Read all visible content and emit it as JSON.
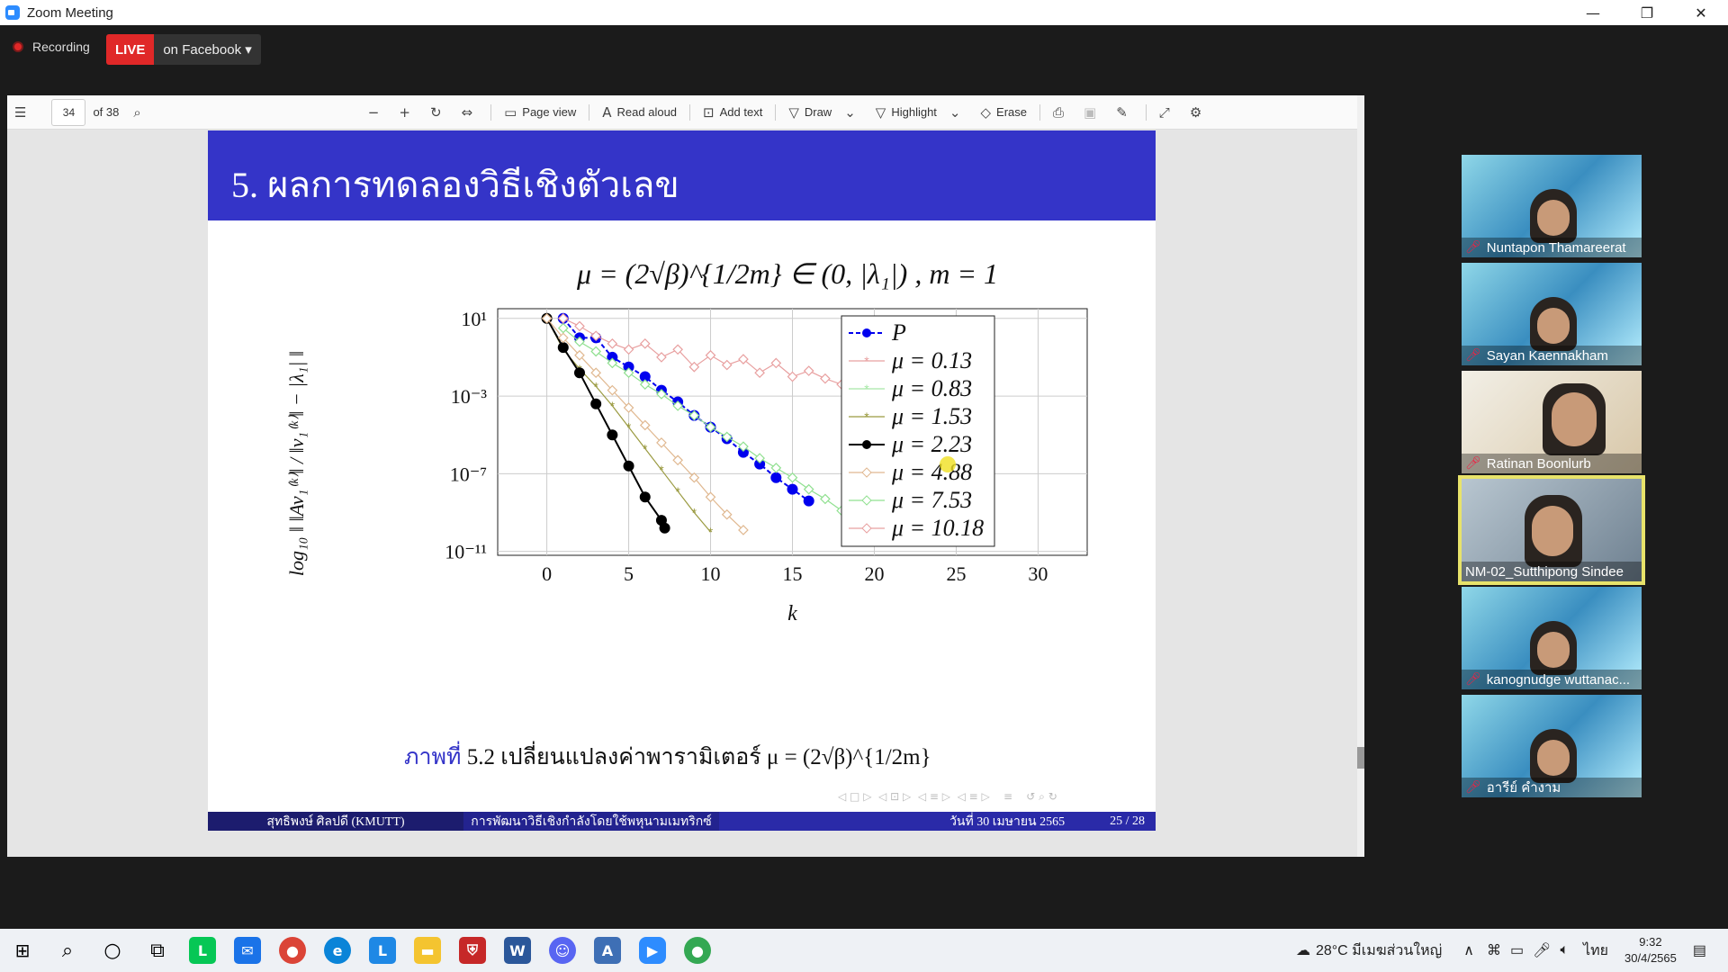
{
  "window": {
    "title": "Zoom Meeting"
  },
  "recording": {
    "label": "Recording",
    "live_badge": "LIVE",
    "live_target": "on Facebook"
  },
  "pdf_toolbar": {
    "page_current": "34",
    "page_total": "of 38",
    "page_view": "Page view",
    "read_aloud": "Read aloud",
    "add_text": "Add text",
    "draw": "Draw",
    "highlight": "Highlight",
    "erase": "Erase"
  },
  "slide": {
    "title": "5. ผลการทดลองวิธีเชิงตัวเลข",
    "formula": "μ = (2√β)^{1/2m} ∈ (0, |λ₁|) , m = 1",
    "y_axis_label": "log₁₀ ‖ ‖Av₁⁽ᵏ⁾‖ / ‖v₁⁽ᵏ⁾‖ − |λ₁| ‖",
    "caption_fig": "ภาพที่",
    "caption_text": "5.2 เปลี่ยนแปลงค่าพารามิเตอร์ μ = (2√β)^{1/2m}",
    "footer_author": "สุทธิพงษ์ ศิลปดี (KMUTT)",
    "footer_title": "การพัฒนาวิธีเชิงกำลังโดยใช้พหุนามเมทริกซ์",
    "footer_date": "วันที่ 30 เมษายน 2565",
    "footer_page": "25 / 28"
  },
  "chart_data": {
    "type": "line",
    "xlabel": "k",
    "x_ticks": [
      "0",
      "5",
      "10",
      "15",
      "20",
      "25",
      "30"
    ],
    "y_ticks": [
      "10¹",
      "10⁻³",
      "10⁻⁷",
      "10⁻¹¹"
    ],
    "xlim": [
      -3,
      33
    ],
    "ylim_log10": [
      -11.2,
      1.5
    ],
    "y_scale": "log",
    "grid": true,
    "legend_position": "right",
    "series": [
      {
        "name": "P",
        "color": "#0000ee",
        "marker": "dot",
        "dashed": true,
        "points": [
          [
            1,
            1
          ],
          [
            2,
            0
          ],
          [
            3,
            0
          ],
          [
            4,
            -1
          ],
          [
            5,
            -1.5
          ],
          [
            6,
            -2
          ],
          [
            7,
            -2.7
          ],
          [
            8,
            -3.3
          ],
          [
            9,
            -4
          ],
          [
            10,
            -4.6
          ],
          [
            11,
            -5.2
          ],
          [
            12,
            -5.9
          ],
          [
            13,
            -6.5
          ],
          [
            14,
            -7.2
          ],
          [
            15,
            -7.8
          ],
          [
            16,
            -8.4
          ]
        ]
      },
      {
        "name": "μ = 0.13",
        "color": "#e8a0a0",
        "marker": "star",
        "points": []
      },
      {
        "name": "μ = 0.83",
        "color": "#a8e8a8",
        "marker": "star",
        "points": []
      },
      {
        "name": "μ = 1.53",
        "color": "#9a9a40",
        "marker": "star",
        "points": [
          [
            0,
            1
          ],
          [
            1,
            -0.6
          ],
          [
            2,
            -1.6
          ],
          [
            3,
            -2.5
          ],
          [
            4,
            -3.5
          ],
          [
            5,
            -4.6
          ],
          [
            6,
            -5.7
          ],
          [
            7,
            -6.8
          ],
          [
            8,
            -7.9
          ],
          [
            9,
            -9
          ],
          [
            10,
            -10
          ]
        ]
      },
      {
        "name": "μ = 2.23",
        "color": "#000000",
        "marker": "dot",
        "points": [
          [
            0,
            1
          ],
          [
            1,
            -0.5
          ],
          [
            2,
            -1.8
          ],
          [
            3,
            -3.4
          ],
          [
            4,
            -5
          ],
          [
            5,
            -6.6
          ],
          [
            6,
            -8.2
          ],
          [
            7,
            -9.4
          ],
          [
            7.2,
            -9.8
          ]
        ]
      },
      {
        "name": "μ = 4.88",
        "color": "#e0b890",
        "marker": "diamond",
        "points": [
          [
            0,
            1
          ],
          [
            1,
            0
          ],
          [
            2,
            -0.9
          ],
          [
            3,
            -1.8
          ],
          [
            4,
            -2.7
          ],
          [
            5,
            -3.6
          ],
          [
            6,
            -4.5
          ],
          [
            7,
            -5.4
          ],
          [
            8,
            -6.3
          ],
          [
            9,
            -7.2
          ],
          [
            10,
            -8.2
          ],
          [
            11,
            -9.1
          ],
          [
            12,
            -9.9
          ]
        ]
      },
      {
        "name": "μ = 7.53",
        "color": "#90e090",
        "marker": "diamond",
        "points": [
          [
            1,
            0.5
          ],
          [
            2,
            -0.2
          ],
          [
            3,
            -0.7
          ],
          [
            4,
            -1.3
          ],
          [
            5,
            -1.8
          ],
          [
            6,
            -2.4
          ],
          [
            7,
            -2.9
          ],
          [
            8,
            -3.5
          ],
          [
            9,
            -4
          ],
          [
            10,
            -4.6
          ],
          [
            11,
            -5.1
          ],
          [
            12,
            -5.6
          ],
          [
            13,
            -6.2
          ],
          [
            14,
            -6.7
          ],
          [
            15,
            -7.2
          ],
          [
            16,
            -7.8
          ],
          [
            17,
            -8.3
          ],
          [
            18,
            -8.9
          ],
          [
            19,
            -9.4
          ]
        ]
      },
      {
        "name": "μ = 10.18",
        "color": "#e8a0a0",
        "marker": "diamond",
        "points": [
          [
            1,
            1
          ],
          [
            2,
            0.6
          ],
          [
            3,
            0.1
          ],
          [
            4,
            -0.3
          ],
          [
            5,
            -0.6
          ],
          [
            6,
            -0.3
          ],
          [
            7,
            -1
          ],
          [
            8,
            -0.6
          ],
          [
            9,
            -1.5
          ],
          [
            10,
            -0.9
          ],
          [
            11,
            -1.4
          ],
          [
            12,
            -1.1
          ],
          [
            13,
            -1.8
          ],
          [
            14,
            -1.3
          ],
          [
            15,
            -2
          ],
          [
            16,
            -1.7
          ],
          [
            17,
            -2.1
          ],
          [
            18,
            -2.4
          ],
          [
            19,
            -1.9
          ],
          [
            20,
            -2.5
          ],
          [
            21,
            -2.4
          ],
          [
            22,
            -2.9
          ],
          [
            23,
            -2.3
          ],
          [
            24,
            -3
          ],
          [
            25,
            -2.7
          ]
        ]
      }
    ]
  },
  "participants": [
    {
      "name": "Nuntapon Thamareerat"
    },
    {
      "name": "Sayan Kaennakham"
    },
    {
      "name": "Ratinan Boonlurb"
    },
    {
      "name": "NM-02_Sutthipong Sindee"
    },
    {
      "name": "kanognudge wuttanac..."
    },
    {
      "name": "อารีย์ คำงาม"
    }
  ],
  "taskbar": {
    "weather": "28°C มีเมฆส่วนใหญ่",
    "language": "ไทย",
    "time": "9:32",
    "date": "30/4/2565"
  }
}
